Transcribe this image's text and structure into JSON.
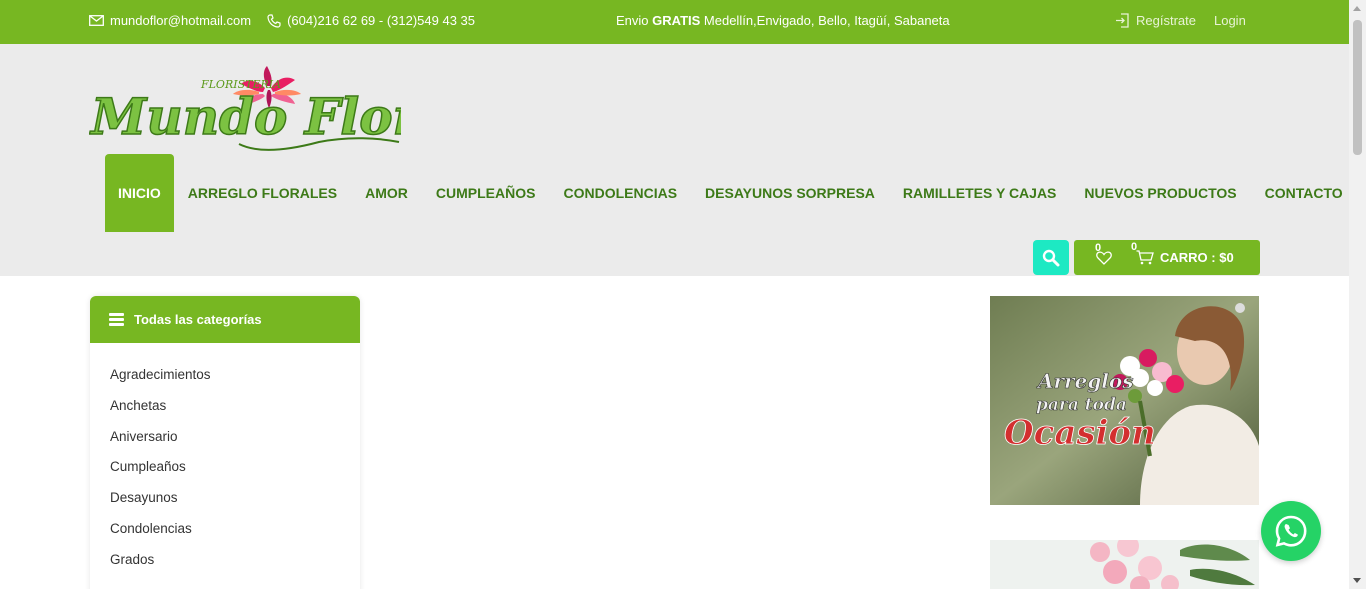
{
  "topbar": {
    "email": "mundoflor@hotmail.com",
    "phone": "(604)216 62 69 - (312)549 43 35",
    "promo_prefix": "Envio ",
    "promo_bold": "GRATIS",
    "promo_suffix": " Medellín,Envigado, Bello, Itagüí, Sabaneta",
    "register": "Regístrate",
    "login": "Login"
  },
  "logo": {
    "small_text": "FLORISTERIA",
    "main_text": "Mundo Flor"
  },
  "nav": [
    {
      "label": "INICIO",
      "active": true
    },
    {
      "label": "ARREGLO FLORALES"
    },
    {
      "label": "AMOR"
    },
    {
      "label": "CUMPLEAÑOS"
    },
    {
      "label": "CONDOLENCIAS"
    },
    {
      "label": "DESAYUNOS SORPRESA"
    },
    {
      "label": "RAMILLETES Y CAJAS"
    },
    {
      "label": "NUEVOS PRODUCTOS"
    },
    {
      "label": "CONTACTO"
    }
  ],
  "cart": {
    "wishlist_count": "0",
    "cart_count": "0",
    "label": "CARRO : $0"
  },
  "categories": {
    "title": "Todas las categorías",
    "items": [
      "Agradecimientos",
      "Anchetas",
      "Aniversario",
      "Cumpleaños",
      "Desayunos",
      "Condolencias",
      "Grados"
    ]
  },
  "banner": {
    "line1": "Arreglos",
    "line2": "para toda",
    "line3": "Ocasión"
  },
  "colors": {
    "brand_green": "#77b722",
    "nav_text": "#3d7a18",
    "search_accent": "#1de9c3",
    "whatsapp": "#25d366"
  }
}
